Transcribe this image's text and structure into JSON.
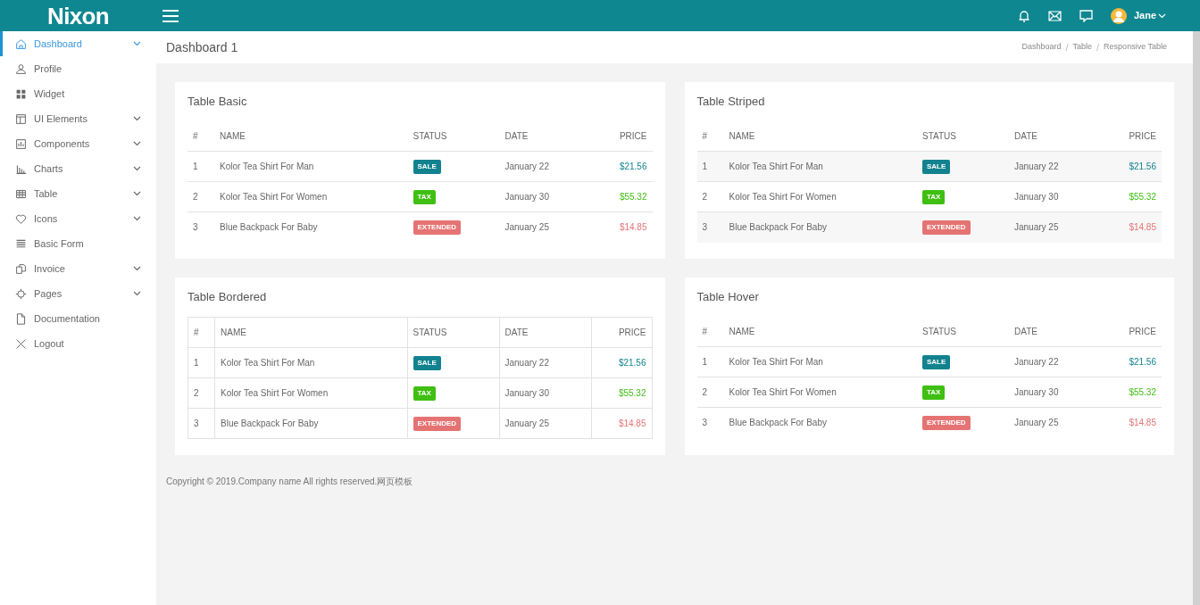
{
  "header": {
    "logo": "Nixon",
    "user": "Jane"
  },
  "sidebar": {
    "items": [
      {
        "label": "Dashboard",
        "expandable": true,
        "selected": true
      },
      {
        "label": "Profile",
        "expandable": false,
        "selected": false
      },
      {
        "label": "Widget",
        "expandable": false,
        "selected": false
      },
      {
        "label": "UI Elements",
        "expandable": true,
        "selected": false
      },
      {
        "label": "Components",
        "expandable": true,
        "selected": false
      },
      {
        "label": "Charts",
        "expandable": true,
        "selected": false
      },
      {
        "label": "Table",
        "expandable": true,
        "selected": false
      },
      {
        "label": "Icons",
        "expandable": true,
        "selected": false
      },
      {
        "label": "Basic Form",
        "expandable": false,
        "selected": false
      },
      {
        "label": "Invoice",
        "expandable": true,
        "selected": false
      },
      {
        "label": "Pages",
        "expandable": true,
        "selected": false
      },
      {
        "label": "Documentation",
        "expandable": false,
        "selected": false
      },
      {
        "label": "Logout",
        "expandable": false,
        "selected": false
      }
    ]
  },
  "page_title": "Dashboard 1",
  "breadcrumb": {
    "separator": "/",
    "items": [
      "Dashboard",
      "Table",
      "Responsive Table"
    ]
  },
  "tables": [
    {
      "title": "Table Basic",
      "kind": "basic",
      "columns": [
        "#",
        "NAME",
        "STATUS",
        "DATE",
        "PRICE"
      ],
      "rows": [
        {
          "n": "1",
          "name": "Kolor Tea Shirt For Man",
          "status": "SALE",
          "color": "#12828f",
          "date": "January 22",
          "price": "$21.56"
        },
        {
          "n": "2",
          "name": "Kolor Tea Shirt For Women",
          "status": "TAX",
          "color": "#3fbf12",
          "date": "January 30",
          "price": "$55.32"
        },
        {
          "n": "3",
          "name": "Blue Backpack For Baby",
          "status": "EXTENDED",
          "color": "#e57373",
          "date": "January 25",
          "price": "$14.85"
        }
      ]
    },
    {
      "title": "Table Striped",
      "kind": "striped",
      "columns": [
        "#",
        "NAME",
        "STATUS",
        "DATE",
        "PRICE"
      ],
      "rows": [
        {
          "n": "1",
          "name": "Kolor Tea Shirt For Man",
          "status": "SALE",
          "color": "#12828f",
          "date": "January 22",
          "price": "$21.56"
        },
        {
          "n": "2",
          "name": "Kolor Tea Shirt For Women",
          "status": "TAX",
          "color": "#3fbf12",
          "date": "January 30",
          "price": "$55.32"
        },
        {
          "n": "3",
          "name": "Blue Backpack For Baby",
          "status": "EXTENDED",
          "color": "#e57373",
          "date": "January 25",
          "price": "$14.85"
        }
      ]
    },
    {
      "title": "Table Bordered",
      "kind": "bordered",
      "columns": [
        "#",
        "NAME",
        "STATUS",
        "DATE",
        "PRICE"
      ],
      "rows": [
        {
          "n": "1",
          "name": "Kolor Tea Shirt For Man",
          "status": "SALE",
          "color": "#12828f",
          "date": "January 22",
          "price": "$21.56"
        },
        {
          "n": "2",
          "name": "Kolor Tea Shirt For Women",
          "status": "TAX",
          "color": "#3fbf12",
          "date": "January 30",
          "price": "$55.32"
        },
        {
          "n": "3",
          "name": "Blue Backpack For Baby",
          "status": "EXTENDED",
          "color": "#e57373",
          "date": "January 25",
          "price": "$14.85"
        }
      ]
    },
    {
      "title": "Table Hover",
      "kind": "hover",
      "columns": [
        "#",
        "NAME",
        "STATUS",
        "DATE",
        "PRICE"
      ],
      "rows": [
        {
          "n": "1",
          "name": "Kolor Tea Shirt For Man",
          "status": "SALE",
          "color": "#12828f",
          "date": "January 22",
          "price": "$21.56"
        },
        {
          "n": "2",
          "name": "Kolor Tea Shirt For Women",
          "status": "TAX",
          "color": "#3fbf12",
          "date": "January 30",
          "price": "$55.32"
        },
        {
          "n": "3",
          "name": "Blue Backpack For Baby",
          "status": "EXTENDED",
          "color": "#e57373",
          "date": "January 25",
          "price": "$14.85"
        }
      ]
    }
  ],
  "footer": "Copyright © 2019.Company name All rights reserved.网页模板"
}
